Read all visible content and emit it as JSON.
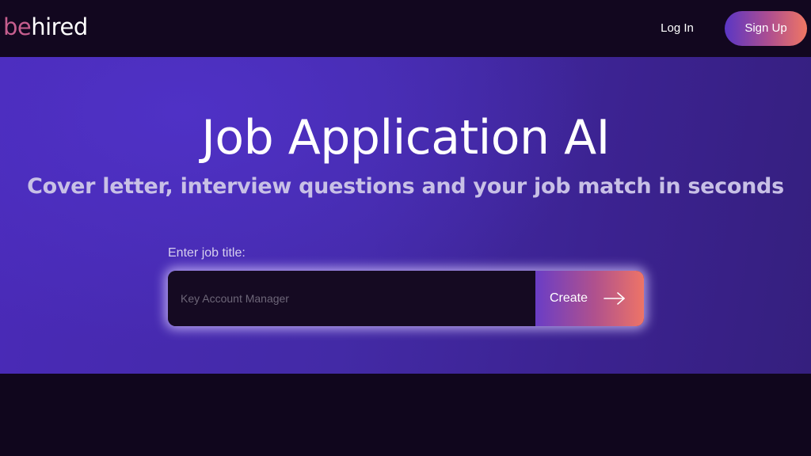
{
  "brand": {
    "prefix": "be",
    "suffix": "hired"
  },
  "nav": {
    "login_label": "Log In",
    "signup_label": "Sign Up"
  },
  "hero": {
    "title": "Job Application AI",
    "subtitle": "Cover letter, interview questions and your job match in seconds",
    "field_label": "Enter job title:",
    "input_placeholder": "Key Account Manager",
    "input_value": "",
    "create_label": "Create",
    "create_icon": "arrow-right-icon"
  },
  "colors": {
    "brand_pink": "#c65e8e",
    "gradient_start": "#5a36c4",
    "gradient_end": "#f07763",
    "hero_bg": "#432aa6",
    "dark_bg": "#12071f"
  }
}
